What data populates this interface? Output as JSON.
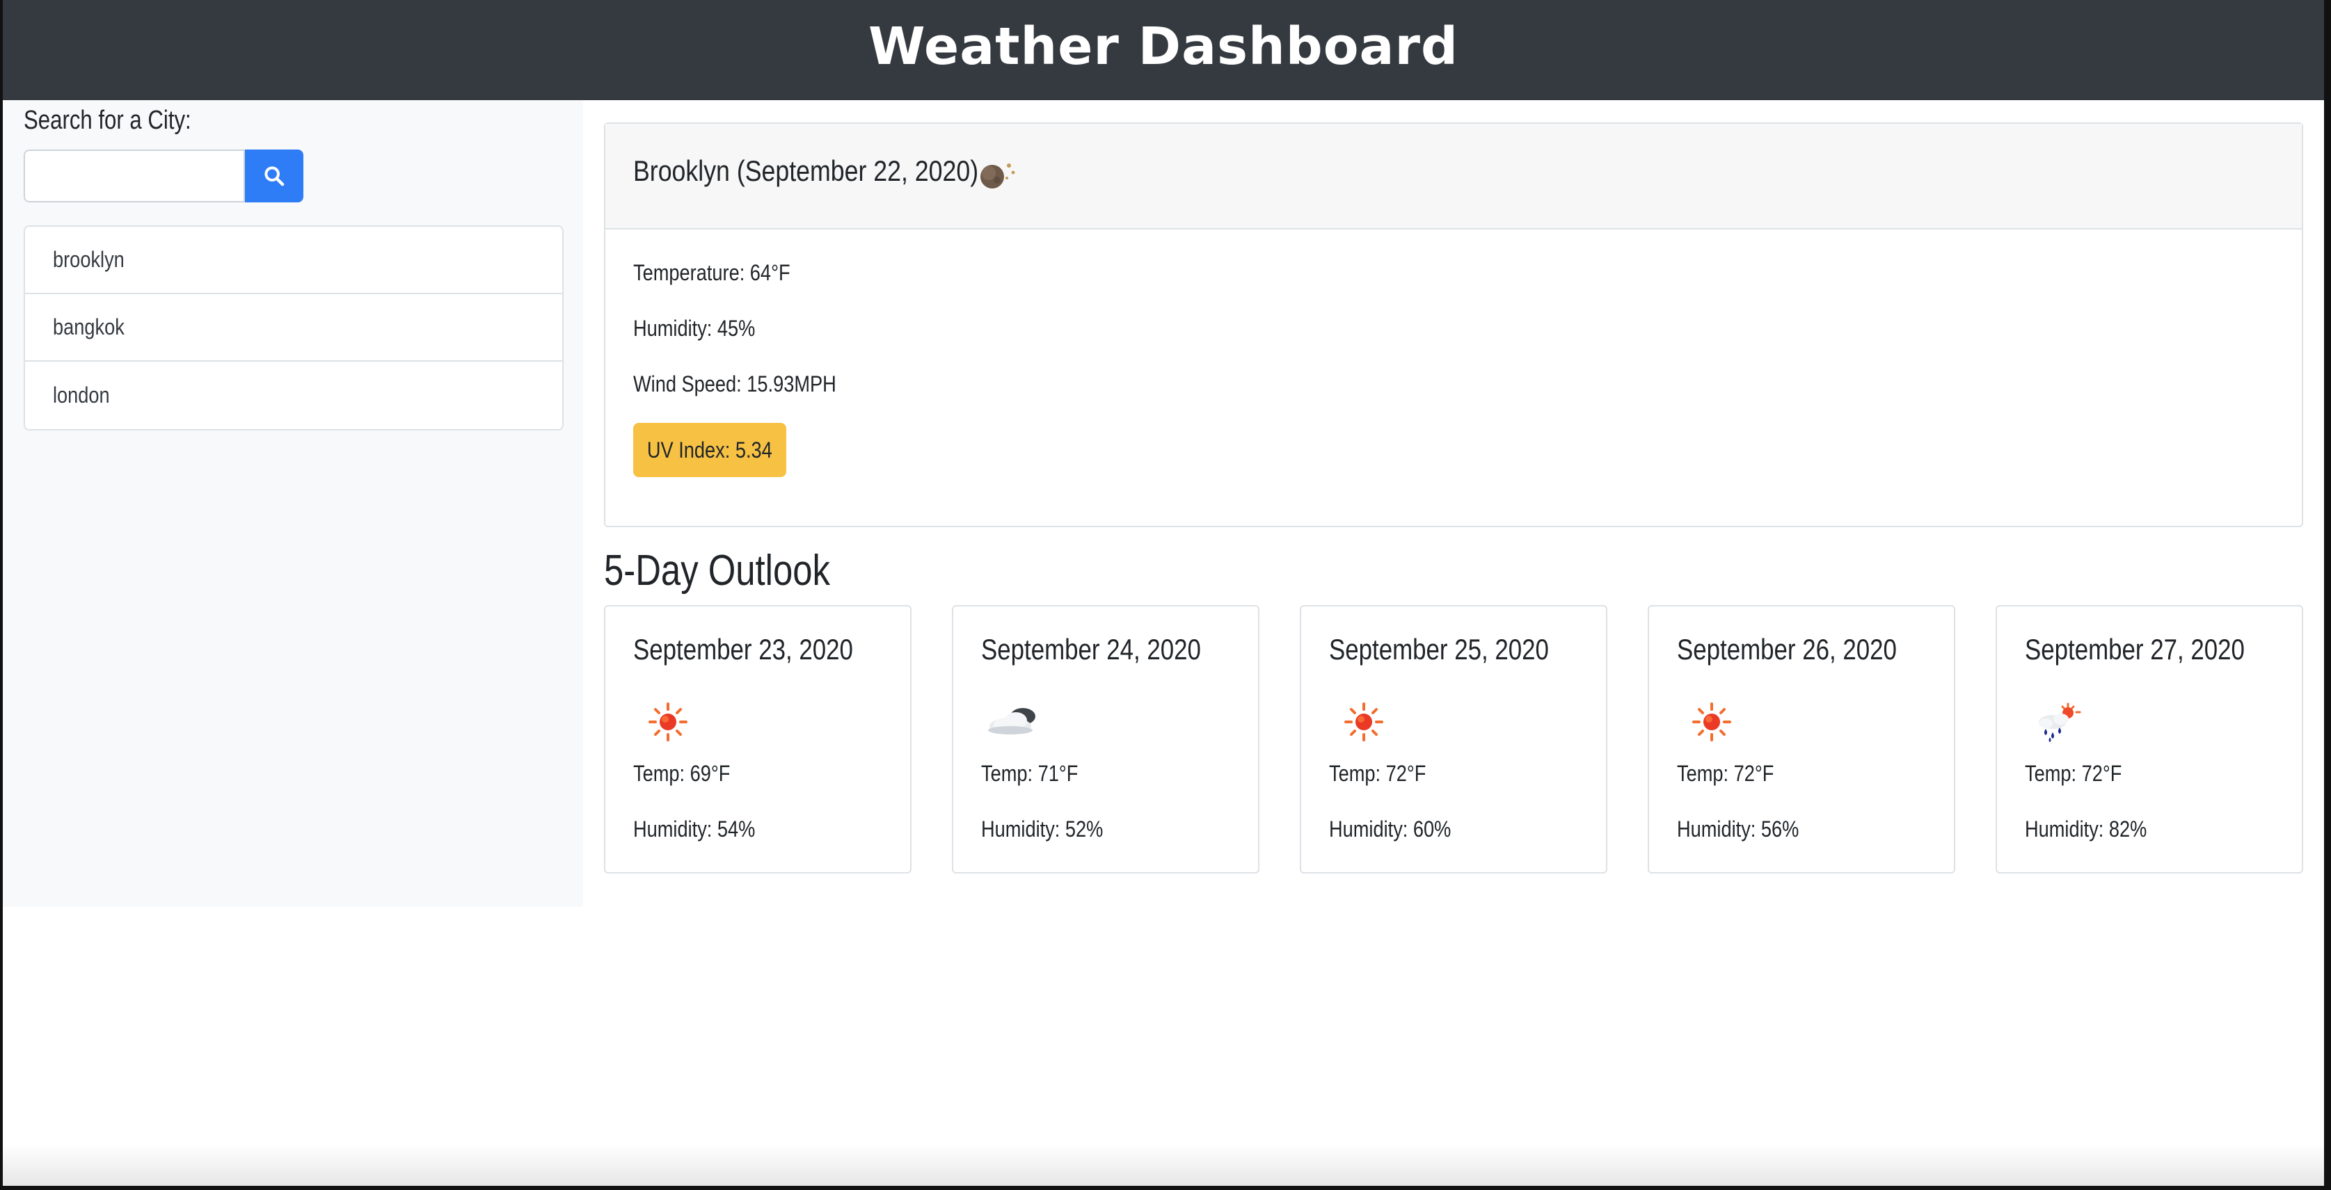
{
  "header": {
    "title": "Weather Dashboard"
  },
  "sidebar": {
    "search_label": "Search for a City:",
    "search_input_value": "",
    "search_button_icon": "search-icon",
    "cities": [
      "brooklyn",
      "bangkok",
      "london"
    ]
  },
  "current": {
    "title": "Brooklyn (September 22, 2020)",
    "icon": "clear-night-icon",
    "temperature": "Temperature: 64°F",
    "humidity": "Humidity: 45%",
    "wind": "Wind Speed: 15.93MPH",
    "uv": "UV Index: 5.34",
    "uv_color": "#f7c244"
  },
  "outlook": {
    "title": "5-Day Outlook",
    "days": [
      {
        "date": "September 23, 2020",
        "icon": "sun-icon",
        "temp": "Temp: 69°F",
        "humidity": "Humidity: 54%"
      },
      {
        "date": "September 24, 2020",
        "icon": "cloud-icon",
        "temp": "Temp: 71°F",
        "humidity": "Humidity: 52%"
      },
      {
        "date": "September 25, 2020",
        "icon": "sun-icon",
        "temp": "Temp: 72°F",
        "humidity": "Humidity: 60%"
      },
      {
        "date": "September 26, 2020",
        "icon": "sun-icon",
        "temp": "Temp: 72°F",
        "humidity": "Humidity: 56%"
      },
      {
        "date": "September 27, 2020",
        "icon": "rain-sun-icon",
        "temp": "Temp: 72°F",
        "humidity": "Humidity: 82%"
      }
    ]
  },
  "colors": {
    "header_bg": "#343a40",
    "sidebar_bg": "#f8f9fa",
    "primary_button": "#2f7df6",
    "card_header_bg": "#f7f7f7",
    "border": "#dee2e6"
  }
}
